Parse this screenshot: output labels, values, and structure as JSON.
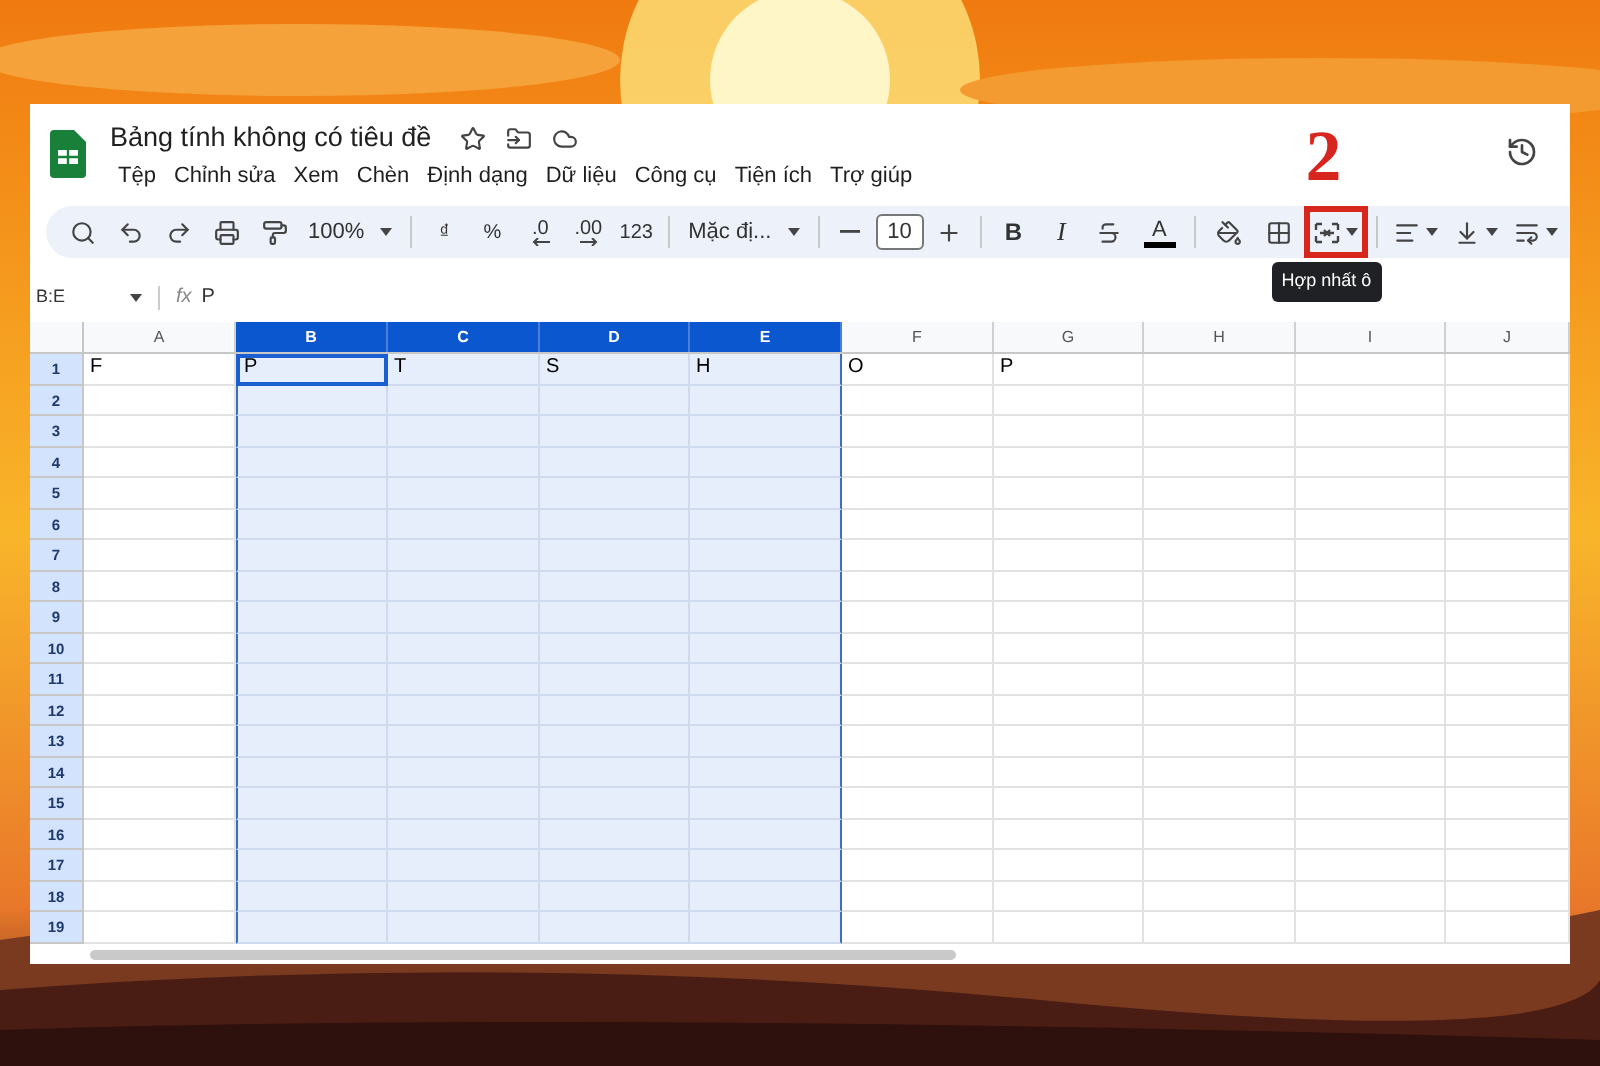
{
  "document": {
    "title": "Bảng tính không có tiêu đề"
  },
  "menu": [
    "Tệp",
    "Chỉnh sửa",
    "Xem",
    "Chèn",
    "Định dạng",
    "Dữ liệu",
    "Công cụ",
    "Tiện ích",
    "Trợ giúp"
  ],
  "toolbar": [
    {
      "kind": "search"
    },
    {
      "kind": "undo"
    },
    {
      "kind": "redo"
    },
    {
      "kind": "print"
    },
    {
      "kind": "paint"
    },
    {
      "kind": "dropdown",
      "label": "100%"
    },
    {
      "kind": "divider"
    },
    {
      "kind": "text",
      "label": "₫"
    },
    {
      "kind": "text",
      "label": "%"
    },
    {
      "kind": "decimal-less",
      "label": ".0"
    },
    {
      "kind": "decimal-more",
      "label": ".00"
    },
    {
      "kind": "text",
      "label": "123"
    },
    {
      "kind": "divider"
    },
    {
      "kind": "dropdown",
      "label": "Mặc đị..."
    },
    {
      "kind": "divider"
    },
    {
      "kind": "minus"
    },
    {
      "kind": "field",
      "value": "10"
    },
    {
      "kind": "plus"
    },
    {
      "kind": "divider"
    },
    {
      "kind": "bold",
      "label": "B"
    },
    {
      "kind": "italic",
      "label": "I"
    },
    {
      "kind": "strike"
    },
    {
      "kind": "textcolor",
      "label": "A"
    },
    {
      "kind": "divider"
    },
    {
      "kind": "fill"
    },
    {
      "kind": "borders"
    },
    {
      "kind": "merge",
      "tooltip": "Hợp nhất ô",
      "annotation": "2"
    },
    {
      "kind": "divider"
    },
    {
      "kind": "align"
    },
    {
      "kind": "valign"
    },
    {
      "kind": "wrap"
    }
  ],
  "formula_bar": {
    "name_box": "B:E",
    "fx": "fx",
    "value": "P"
  },
  "columns": [
    {
      "label": "A",
      "selected": false
    },
    {
      "label": "B",
      "selected": true
    },
    {
      "label": "C",
      "selected": true
    },
    {
      "label": "D",
      "selected": true
    },
    {
      "label": "E",
      "selected": true
    },
    {
      "label": "F",
      "selected": false
    },
    {
      "label": "G",
      "selected": false
    },
    {
      "label": "H",
      "selected": false
    },
    {
      "label": "I",
      "selected": false
    },
    {
      "label": "J",
      "selected": false
    }
  ],
  "rows": [
    {
      "number": "1",
      "cells": [
        {
          "text": "F",
          "active": false
        },
        {
          "text": "P",
          "active": true
        },
        {
          "text": "T",
          "active": false
        },
        {
          "text": "S",
          "active": false
        },
        {
          "text": "H",
          "active": false
        },
        {
          "text": "O",
          "active": false
        },
        {
          "text": "P",
          "active": false
        }
      ]
    },
    {
      "number": "2"
    },
    {
      "number": "3"
    },
    {
      "number": "4"
    },
    {
      "number": "5"
    },
    {
      "number": "6"
    },
    {
      "number": "7"
    },
    {
      "number": "8"
    },
    {
      "number": "9"
    },
    {
      "number": "10"
    },
    {
      "number": "11"
    },
    {
      "number": "12"
    },
    {
      "number": "13"
    },
    {
      "number": "14"
    },
    {
      "number": "15"
    },
    {
      "number": "16"
    },
    {
      "number": "17"
    },
    {
      "number": "18"
    },
    {
      "number": "19"
    }
  ]
}
